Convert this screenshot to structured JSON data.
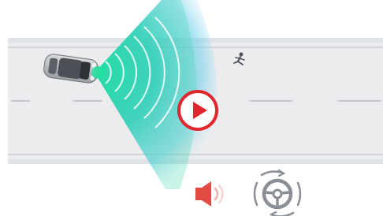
{
  "scene": {
    "description_type": "adas-illustration",
    "road": {
      "lanes": 3,
      "road_color": "#ececee",
      "line_color": "#c9ccd1",
      "shoulder_color": "#dfe3e8"
    },
    "radar": {
      "color_inner": "#2bd9a8",
      "color_outer": "#5ad0e6",
      "wave_color": "#ffffff"
    },
    "pedestrian_icon": "pedestrian-icon",
    "vehicle_icon": "car-topdown-icon"
  },
  "video": {
    "play_icon": "play-icon",
    "accent": "#e0262e"
  },
  "alerts": {
    "audio_icon": "speaker-alert-icon",
    "audio_color": "#e04b42",
    "steering_icon": "steering-vibration-icon",
    "steering_color": "#8a8f96"
  }
}
